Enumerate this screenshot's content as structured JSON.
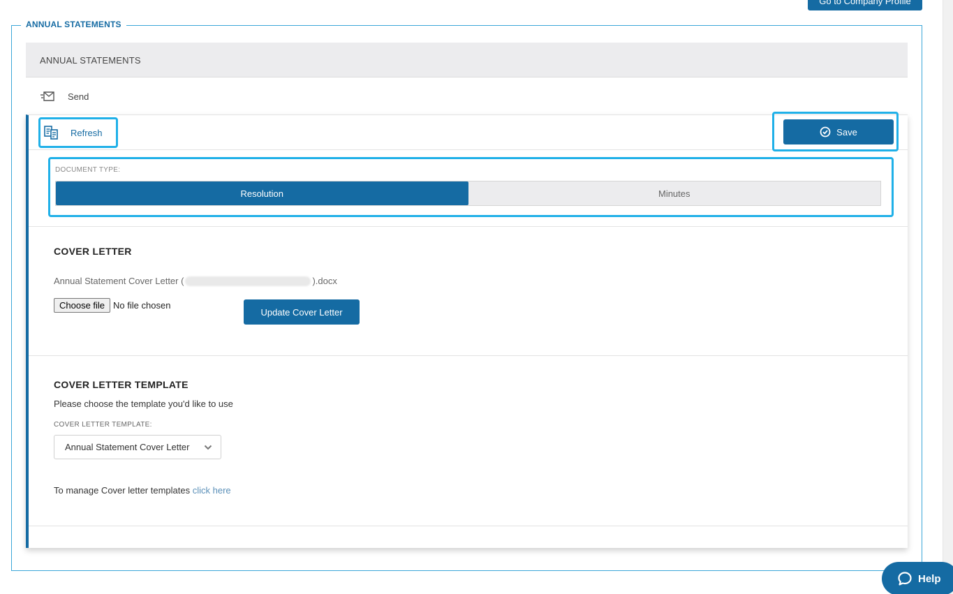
{
  "top_button": {
    "label": "Go to Company Profile"
  },
  "fieldset": {
    "legend": "ANNUAL STATEMENTS"
  },
  "tab_header": {
    "title": "ANNUAL STATEMENTS"
  },
  "send": {
    "label": "Send",
    "icon": "envelope-send-icon"
  },
  "toolbar": {
    "refresh_label": "Refresh",
    "refresh_icon": "refresh-document-icon",
    "save_label": "Save",
    "save_icon": "check-circle-icon"
  },
  "document_type": {
    "label": "DOCUMENT TYPE:",
    "options": [
      {
        "label": "Resolution",
        "selected": true
      },
      {
        "label": "Minutes",
        "selected": false
      }
    ]
  },
  "cover_letter": {
    "title": "COVER LETTER",
    "file_prefix": "Annual Statement Cover Letter (",
    "file_suffix": ").docx",
    "choose_button": "Choose file",
    "no_file": "No file chosen",
    "update_button": "Update Cover Letter"
  },
  "template": {
    "title": "COVER LETTER TEMPLATE",
    "description": "Please choose the template you'd like to use",
    "select_label": "COVER LETTER TEMPLATE:",
    "selected_value": "Annual Statement Cover Letter",
    "manage_text": "To manage Cover letter templates ",
    "manage_link": "click here"
  },
  "help": {
    "label": "Help",
    "icon": "chat-bubble-icon"
  },
  "colors": {
    "primary": "#156ba3",
    "highlight": "#1fb0e8",
    "fieldset_border": "#3aa6d8"
  }
}
